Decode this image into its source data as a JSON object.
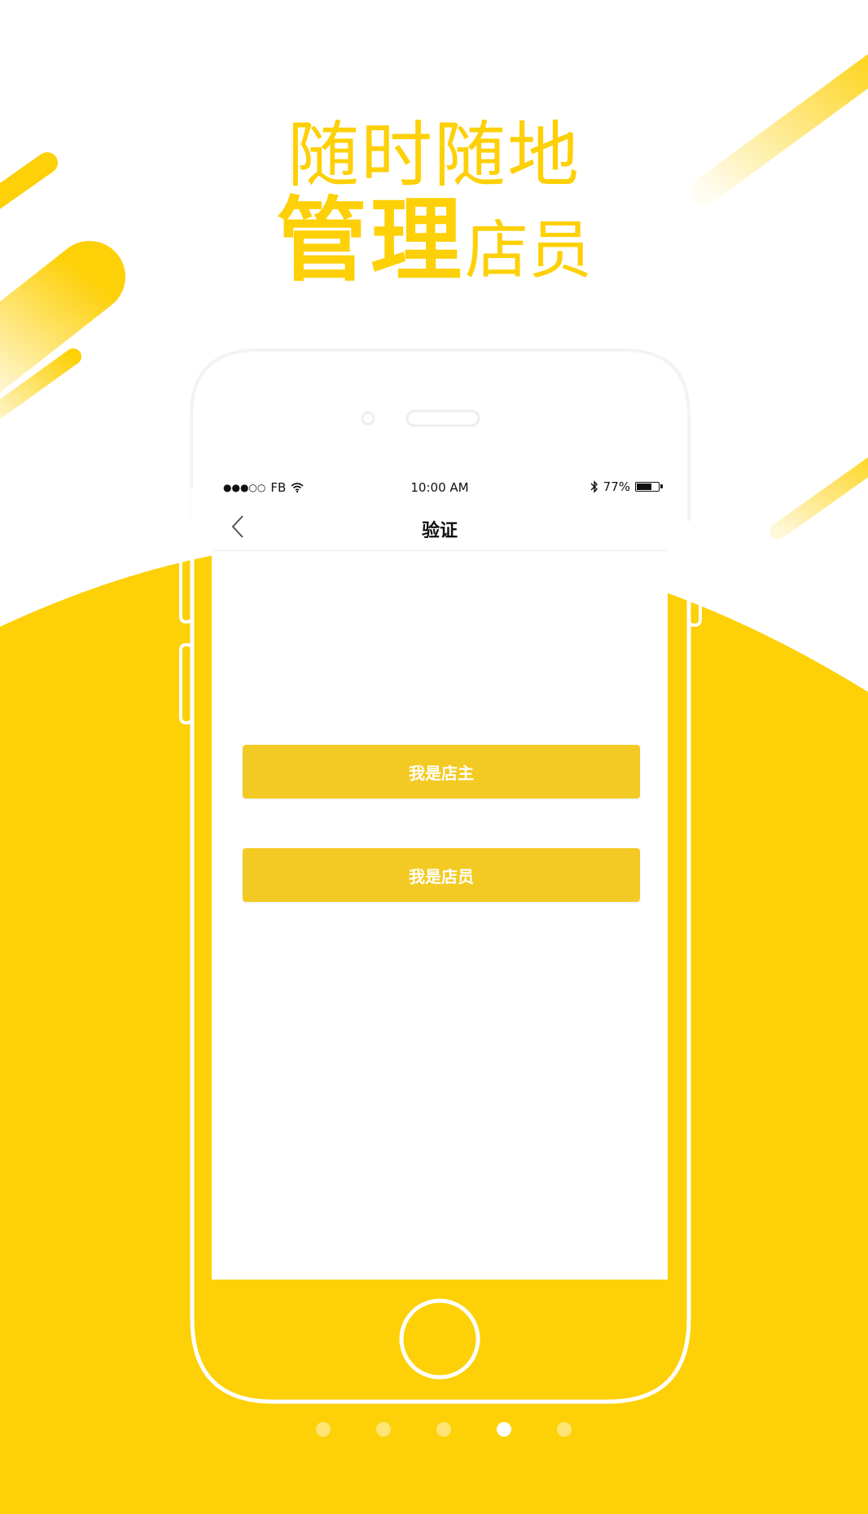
{
  "headline": {
    "line1": "随时随地",
    "line2_bold": "管理",
    "line2_regular": "店员"
  },
  "status_bar": {
    "carrier": "FB",
    "time": "10:00 AM",
    "battery_text": "77%",
    "battery_level": 0.77,
    "icons": [
      "signal-dots-icon",
      "wifi-icon",
      "bluetooth-icon",
      "battery-icon"
    ]
  },
  "nav": {
    "title": "验证",
    "back_icon": "chevron-left-icon"
  },
  "buttons": {
    "owner_label": "我是店主",
    "staff_label": "我是店员"
  },
  "pager": {
    "count": 5,
    "active_index": 3
  },
  "colors": {
    "brand_yellow": "#FDD007",
    "button_yellow": "#F3CA24",
    "white": "#FFFFFF"
  }
}
